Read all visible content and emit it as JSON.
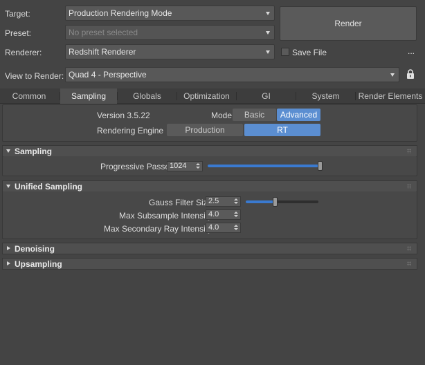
{
  "top": {
    "target_label": "Target:",
    "target_value": "Production Rendering Mode",
    "preset_label": "Preset:",
    "preset_value": "No preset selected",
    "renderer_label": "Renderer:",
    "renderer_value": "Redshift Renderer",
    "render_button": "Render",
    "save_file_label": "Save File",
    "more_label": "...",
    "view_label": "View to Render:",
    "view_value": "Quad 4 - Perspective",
    "lock_icon": "lock-icon"
  },
  "tabs": [
    {
      "label": "Common",
      "active": false
    },
    {
      "label": "Sampling",
      "active": true
    },
    {
      "label": "Globals",
      "active": false
    },
    {
      "label": "Optimization",
      "active": false
    },
    {
      "label": "GI",
      "active": false
    },
    {
      "label": "System",
      "active": false
    },
    {
      "label": "Render Elements",
      "active": false
    }
  ],
  "header_panel": {
    "version": "Version 3.5.22",
    "mode_label": "Mode",
    "mode_basic": "Basic",
    "mode_advanced": "Advanced",
    "mode_selected": "Advanced",
    "engine_label": "Rendering Engine",
    "engine_production": "Production",
    "engine_rt": "RT",
    "engine_selected": "RT"
  },
  "sampling": {
    "title": "Sampling",
    "progressive_label": "Progressive Passes",
    "progressive_value": "1024",
    "progressive_slider_fraction": 1.0
  },
  "unified_sampling": {
    "title": "Unified Sampling",
    "gauss_label": "Gauss Filter Size",
    "gauss_value": "2.5",
    "gauss_slider_fraction": 0.4,
    "max_subsample_label": "Max Subsample Intensity",
    "max_subsample_value": "4.0",
    "max_secondary_label": "Max Secondary Ray Intensity",
    "max_secondary_value": "4.0"
  },
  "denoising": {
    "title": "Denoising"
  },
  "upsampling": {
    "title": "Upsampling"
  },
  "colors": {
    "accent": "#5b8ed1",
    "slider_fill": "#3a7ad0",
    "background": "#444444"
  }
}
